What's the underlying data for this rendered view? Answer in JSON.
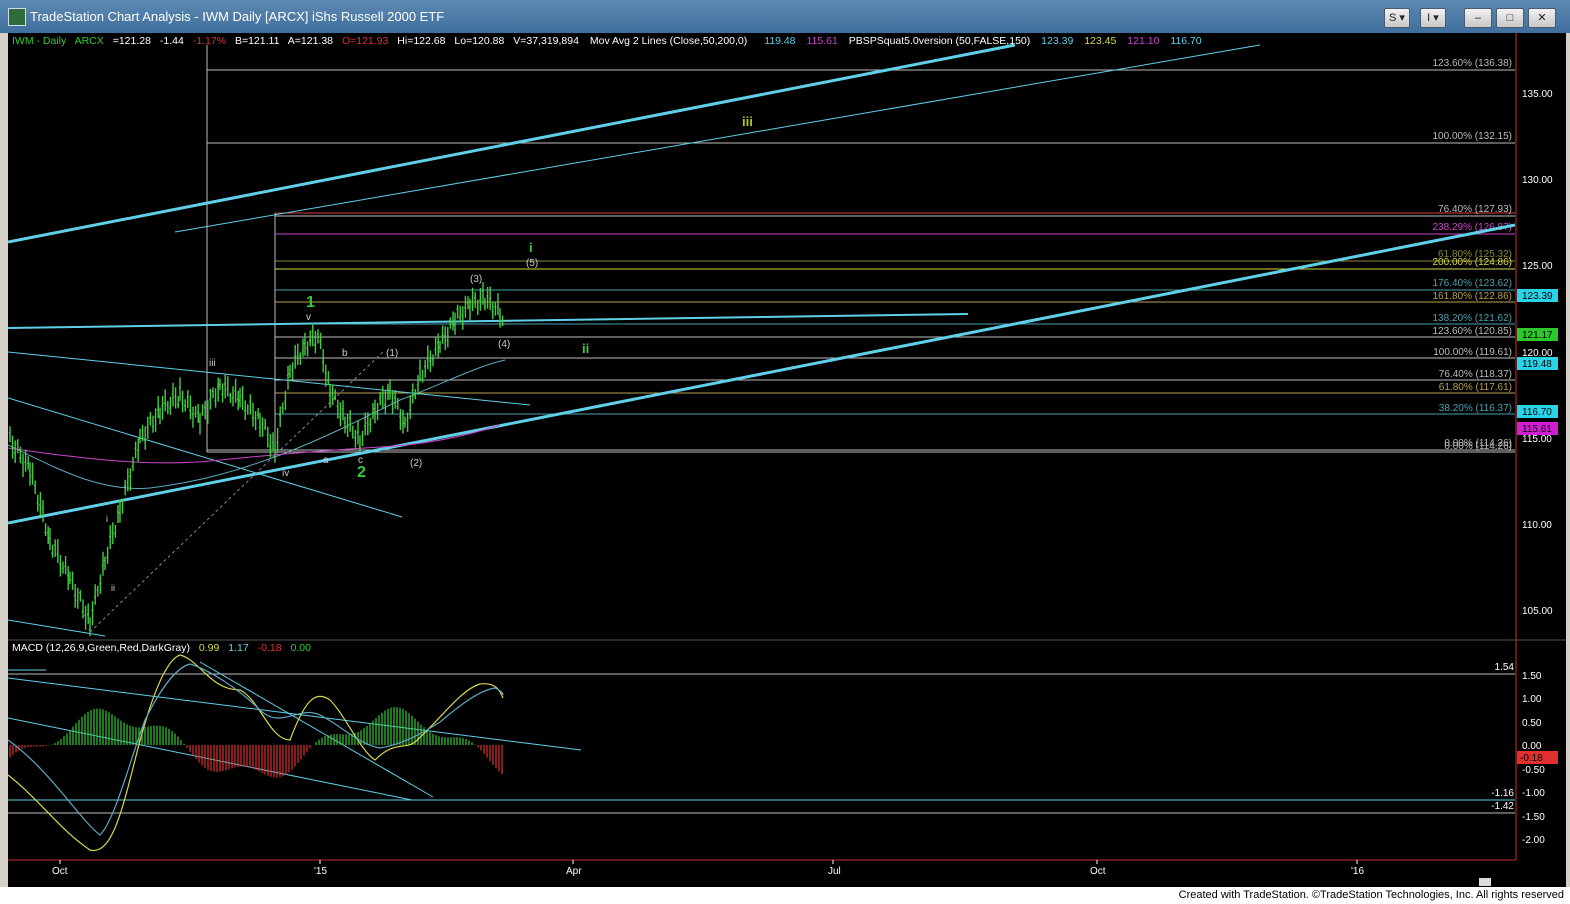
{
  "window": {
    "title": "TradeStation Chart Analysis - IWM Daily [ARCX] iShs Russell 2000 ETF",
    "buttons": {
      "s_label": "S ▾",
      "i_label": "I ▾",
      "min": "–",
      "max": "□",
      "close": "✕"
    }
  },
  "header": {
    "symbol": "IWM - Daily",
    "exchange": "ARCX",
    "last": "=121.28",
    "change": "-1.44",
    "change_pct": "-1.17%",
    "bid": "B=121.11",
    "ask": "A=121.38",
    "open": "O=121.93",
    "high": "Hi=122.68",
    "low": "Lo=120.88",
    "volume": "V=37,319,894",
    "ma_label": "Mov Avg 2 Lines (Close,50,200,0)",
    "ma_val1": "119.48",
    "ma_val2": "115.61",
    "pbs_label": "PBSPSquat5.0version (50,FALSE,150)",
    "pbs_v1": "123.39",
    "pbs_v2": "123.45",
    "pbs_v3": "121.10",
    "pbs_v4": "116.70"
  },
  "colors": {
    "green": "#33cc33",
    "cyan": "#5fd0e8",
    "yellow": "#d8d84a",
    "red": "#e23030",
    "magenta": "#cc44cc",
    "white": "#ffffff",
    "gray": "#a0a0a0"
  },
  "price_axis": {
    "ticks": [
      "135.00",
      "130.00",
      "125.00",
      "120.00",
      "115.00",
      "110.00",
      "105.00"
    ],
    "markers": [
      {
        "value": "123.39",
        "color": "#2bd3e6"
      },
      {
        "value": "121.17",
        "color": "#2cc82c"
      },
      {
        "value": "119.48",
        "color": "#2bd3e6"
      },
      {
        "value": "116.70",
        "color": "#2bd3e6"
      },
      {
        "value": "115.61",
        "color": "#d21ed2"
      }
    ]
  },
  "fib_labels": [
    "123.60% (136.38)",
    "100.00% (132.15)",
    "76.40% (127.93)",
    "238.29% (126.87)",
    "61.80% (125.32)",
    "200.00% (124.86)",
    "176.40% (123.62)",
    "161.80% (122.86)",
    "138.20% (121.62)",
    "123.60% (120.85)",
    "100.00% (119.61)",
    "76.40% (118.37)",
    "61.80% (117.61)",
    "38.20% (116.37)",
    "0.00% (114.26)",
    "0.00% (114.26)"
  ],
  "wave_labels": {
    "iii_big": "iii",
    "i_green": "i",
    "five": "(5)",
    "three": "(3)",
    "one_green": "1",
    "v": "v",
    "b": "b",
    "one_paren": "(1)",
    "four": "(4)",
    "ii": "ii",
    "iii_small": "iii",
    "a": "a",
    "c": "c",
    "iv": "iv",
    "two_green": "2",
    "two_paren": "(2)",
    "i_small": "i",
    "ii_small": "ii"
  },
  "macd": {
    "label": "MACD (12,26,9,Green,Red,DarkGray)",
    "v1": "0.99",
    "v2": "1.17",
    "v3": "-0.18",
    "v4": "0.00",
    "ticks": [
      "1.50",
      "1.00",
      "0.50",
      "0.00",
      "-0.50",
      "-1.00",
      "-1.50",
      "-2.00"
    ],
    "level_top": "1.54",
    "level_mid": "-1.16",
    "level_low": "-1.42",
    "marker": "-0.18"
  },
  "time_axis": [
    "Oct",
    "'15",
    "Apr",
    "Jul",
    "Oct",
    "'16"
  ],
  "status": {
    "copyright": "Created with TradeStation. ©TradeStation Technologies, Inc. All rights reserved"
  }
}
